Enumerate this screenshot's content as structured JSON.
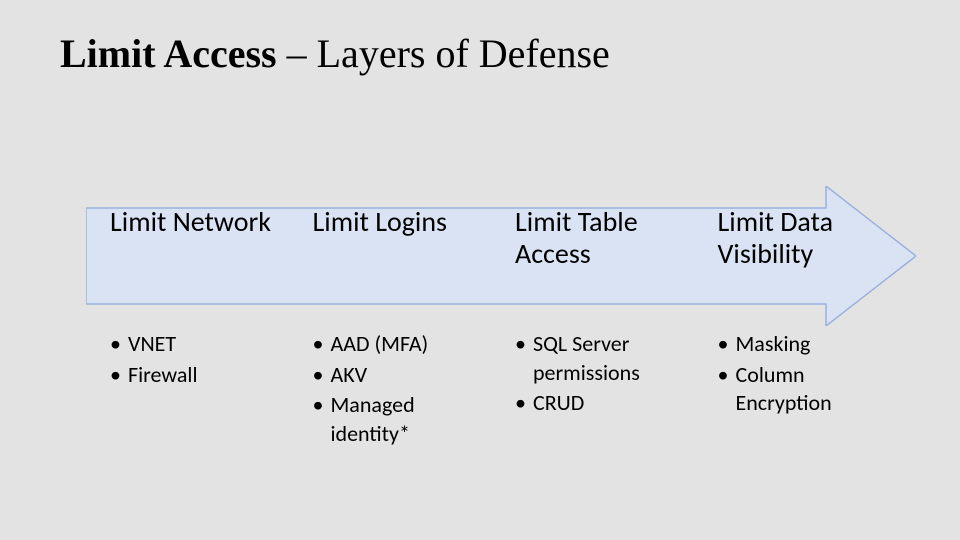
{
  "title": {
    "bold": "Limit Access",
    "rest": " – Layers of Defense"
  },
  "arrow": {
    "fill": "#dae3f3",
    "stroke": "#9ab2de"
  },
  "columns": [
    {
      "heading": "Limit Network",
      "items": [
        "VNET",
        "Firewall"
      ]
    },
    {
      "heading": "Limit Logins",
      "items": [
        "AAD (MFA)",
        "AKV",
        "Managed identity*"
      ]
    },
    {
      "heading": "Limit Table Access",
      "items": [
        "SQL Server permissions",
        "CRUD"
      ]
    },
    {
      "heading": "Limit Data Visibility",
      "items": [
        "Masking",
        "Column Encryption"
      ]
    }
  ]
}
